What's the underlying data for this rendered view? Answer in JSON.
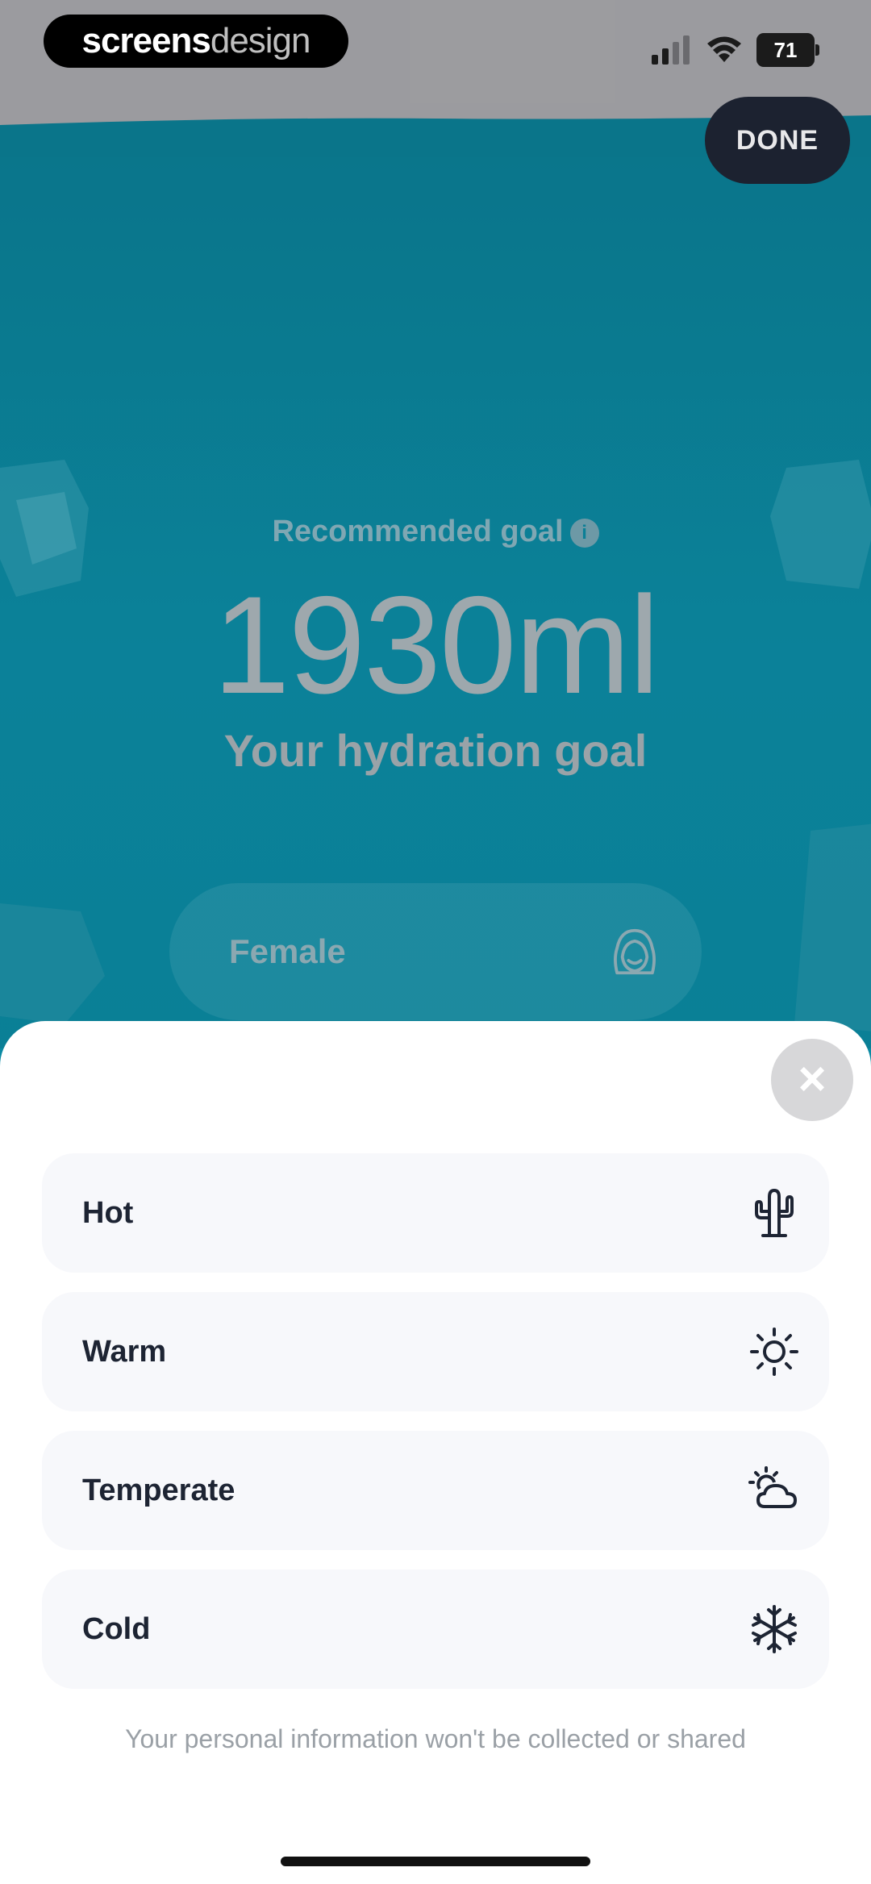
{
  "brand": {
    "part1": "screens",
    "part2": "design"
  },
  "status": {
    "battery": "71"
  },
  "header": {
    "done_label": "DONE"
  },
  "goal_panel": {
    "recommended_label": "Recommended goal",
    "info_glyph": "i",
    "goal_value": "1930ml",
    "goal_subtitle": "Your hydration goal",
    "gender_label": "Female"
  },
  "sheet": {
    "close_glyph": "×",
    "options": [
      {
        "label": "Hot",
        "icon": "cactus-icon"
      },
      {
        "label": "Warm",
        "icon": "sun-icon"
      },
      {
        "label": "Temperate",
        "icon": "sun-cloud-icon"
      },
      {
        "label": "Cold",
        "icon": "snowflake-icon"
      }
    ],
    "privacy_note": "Your personal information won't be collected or shared"
  },
  "colors": {
    "teal": "#0b7f96",
    "dark": "#1c2230",
    "sheet_bg": "#ffffff",
    "option_bg": "#f7f8fb"
  }
}
